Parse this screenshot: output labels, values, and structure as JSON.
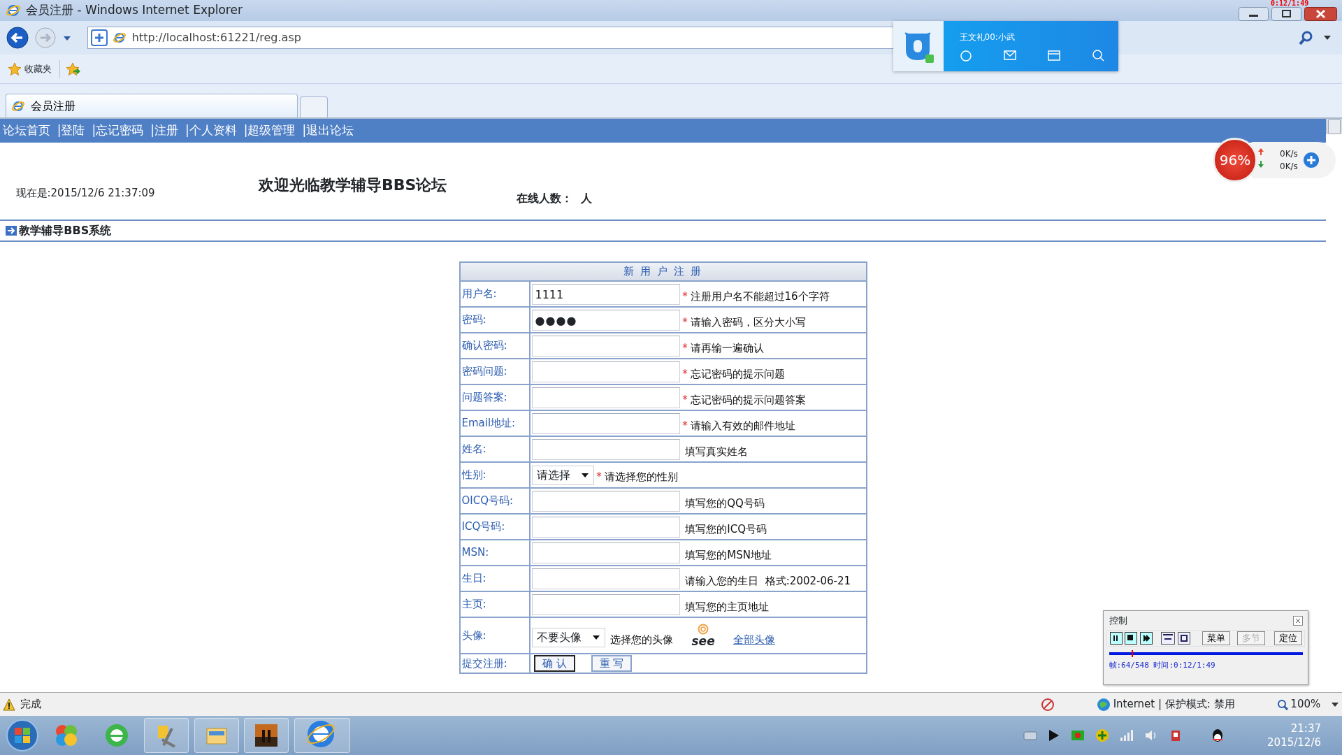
{
  "window": {
    "title": "会员注册 - Windows Internet Explorer",
    "timer": "0:12/1:49"
  },
  "address_bar": {
    "url": "http://localhost:61221/reg.asp"
  },
  "favorites_bar": {
    "label": "收藏夹"
  },
  "tabs": [
    {
      "label": "会员注册",
      "selected": true
    }
  ],
  "qq_popup": {
    "name": "王文礼00:小武"
  },
  "net_widget": {
    "percent": "96%",
    "upload": "0K/s",
    "download": "0K/s"
  },
  "nav": [
    "论坛首页",
    "|登陆",
    "|忘记密码",
    "|注册",
    "|个人资料",
    "|超级管理",
    "|退出论坛"
  ],
  "header": {
    "datetime": "现在是:2015/12/6 21:37:09",
    "title": "欢迎光临教学辅导BBS论坛",
    "online": "在线人数：  人"
  },
  "section": "教学辅导BBS系统",
  "form": {
    "title": "新 用 户 注 册",
    "rows": [
      {
        "kind": "text",
        "label": "用户名:",
        "value": "1111",
        "mark": "*",
        "hint": "注册用户名不能超过16个字符"
      },
      {
        "kind": "password",
        "label": "密码:",
        "value": "●●●●",
        "mark": "*",
        "hint": "请输入密码，区分大小写"
      },
      {
        "kind": "password",
        "label": "确认密码:",
        "mark": "*",
        "hint": "请再输一遍确认"
      },
      {
        "kind": "text",
        "label": "密码问题:",
        "mark": "*",
        "hint": "忘记密码的提示问题"
      },
      {
        "kind": "text",
        "label": "问题答案:",
        "mark": "*",
        "hint": "忘记密码的提示问题答案"
      },
      {
        "kind": "text",
        "label": "Email地址:",
        "mark": "*",
        "hint": "请输入有效的邮件地址"
      },
      {
        "kind": "text",
        "label": "姓名:",
        "hint": "填写真实姓名"
      },
      {
        "kind": "select",
        "label": "性别:",
        "value": "请选择",
        "mark": "*",
        "hint": "请选择您的性别"
      },
      {
        "kind": "text",
        "label": "OICQ号码:",
        "hint": "填写您的QQ号码"
      },
      {
        "kind": "text",
        "label": "ICQ号码:",
        "hint": "填写您的ICQ号码"
      },
      {
        "kind": "text",
        "label": "MSN:",
        "hint": "填写您的MSN地址"
      },
      {
        "kind": "text",
        "label": "生日:",
        "hint": "请输入您的生日  格式:2002-06-21"
      },
      {
        "kind": "text",
        "label": "主页:",
        "hint": "填写您的主页地址"
      },
      {
        "kind": "avatar",
        "label": "头像:",
        "value": "不要头像",
        "hint": "选择您的头像",
        "avatar_text": "see",
        "link": "全部头像"
      },
      {
        "kind": "buttons",
        "label": "提交注册:",
        "buttons": [
          {
            "label": "确 认",
            "focused": true
          },
          {
            "label": "重 写",
            "focused": false
          }
        ]
      }
    ]
  },
  "status_bar": {
    "text": "完成",
    "zone": "Internet | 保护模式: 禁用",
    "zoom": "100%"
  },
  "control_panel": {
    "title": "控制",
    "buttons": [
      {
        "label": "菜单",
        "disabled": false
      },
      {
        "label": "多节",
        "disabled": true
      },
      {
        "label": "定位",
        "disabled": false
      }
    ],
    "level": 0.117,
    "info": "帧:64/548 时间:0:12/1:49"
  },
  "taskbar": {
    "time": "21:37",
    "date": "2015/12/6"
  }
}
